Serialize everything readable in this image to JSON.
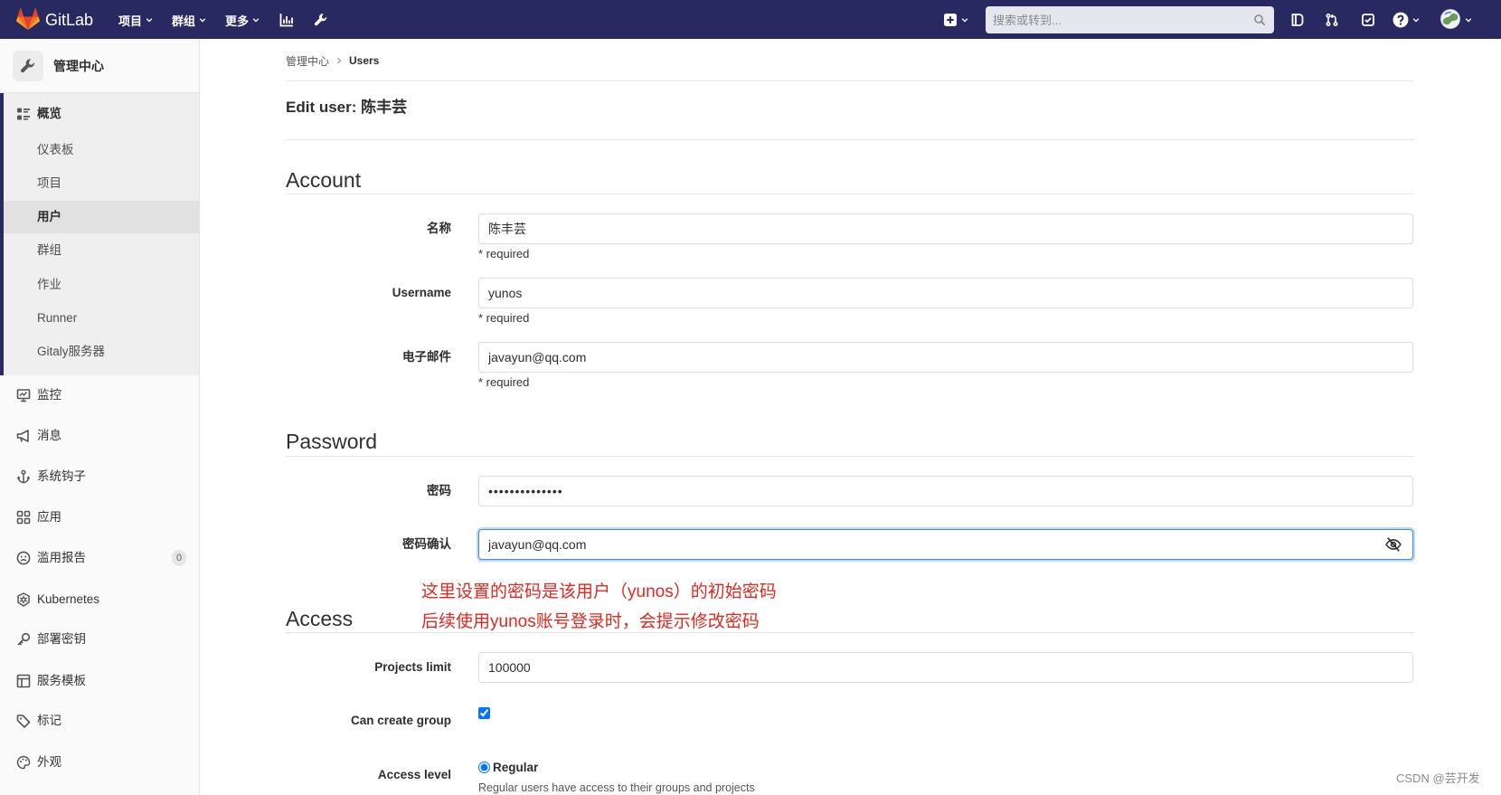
{
  "navbar": {
    "brand": "GitLab",
    "theme_color": "#292961",
    "menus": [
      {
        "label": "项目"
      },
      {
        "label": "群组"
      },
      {
        "label": "更多"
      }
    ],
    "search_placeholder": "搜索或转到...",
    "icons": [
      "activity-chart-icon",
      "admin-wrench-icon",
      "plus-square-icon",
      "search-icon",
      "issues-icon",
      "merge-request-icon",
      "todo-icon",
      "help-icon",
      "user-avatar"
    ]
  },
  "sidebar": {
    "title": "管理中心",
    "overview": {
      "label": "概览",
      "items": [
        {
          "label": "仪表板"
        },
        {
          "label": "项目"
        },
        {
          "label": "用户",
          "active": true
        },
        {
          "label": "群组"
        },
        {
          "label": "作业"
        },
        {
          "label": "Runner"
        },
        {
          "label": "Gitaly服务器"
        }
      ]
    },
    "sections": [
      {
        "label": "监控",
        "icon": "monitor-icon"
      },
      {
        "label": "消息",
        "icon": "megaphone-icon"
      },
      {
        "label": "系统钩子",
        "icon": "hook-icon"
      },
      {
        "label": "应用",
        "icon": "applications-icon"
      },
      {
        "label": "滥用报告",
        "icon": "abuse-report-icon",
        "badge": "0"
      },
      {
        "label": "Kubernetes",
        "icon": "kubernetes-icon"
      },
      {
        "label": "部署密钥",
        "icon": "key-icon"
      },
      {
        "label": "服务模板",
        "icon": "template-icon"
      },
      {
        "label": "标记",
        "icon": "label-icon"
      },
      {
        "label": "外观",
        "icon": "appearance-icon"
      }
    ]
  },
  "breadcrumb": {
    "items": [
      "管理中心",
      "Users"
    ]
  },
  "page_title": "Edit user: 陈丰芸",
  "account": {
    "heading": "Account",
    "fields": [
      {
        "label": "名称",
        "value": "陈丰芸",
        "hint": "* required"
      },
      {
        "label": "Username",
        "value": "yunos",
        "hint": "* required"
      },
      {
        "label": "电子邮件",
        "value": "javayun@qq.com",
        "hint": "* required"
      }
    ]
  },
  "password": {
    "heading": "Password",
    "password_label": "密码",
    "password_value": "••••••••••••••",
    "confirm_label": "密码确认",
    "confirm_value": "javayun@qq.com"
  },
  "annotation": {
    "color": "#e0281e",
    "lines": [
      "这里设置的密码是该用户（yunos）的初始密码",
      "后续使用yunos账号登录时，会提示修改密码"
    ]
  },
  "access": {
    "heading": "Access",
    "projects_limit_label": "Projects limit",
    "projects_limit_value": "100000",
    "can_create_group_label": "Can create group",
    "can_create_group": true,
    "access_level_label": "Access level",
    "access_level_options": [
      {
        "label": "Regular",
        "selected": true,
        "description": "Regular users have access to their groups and projects"
      }
    ]
  },
  "focus_color": "#428fdc",
  "watermark": "CSDN @芸开发"
}
